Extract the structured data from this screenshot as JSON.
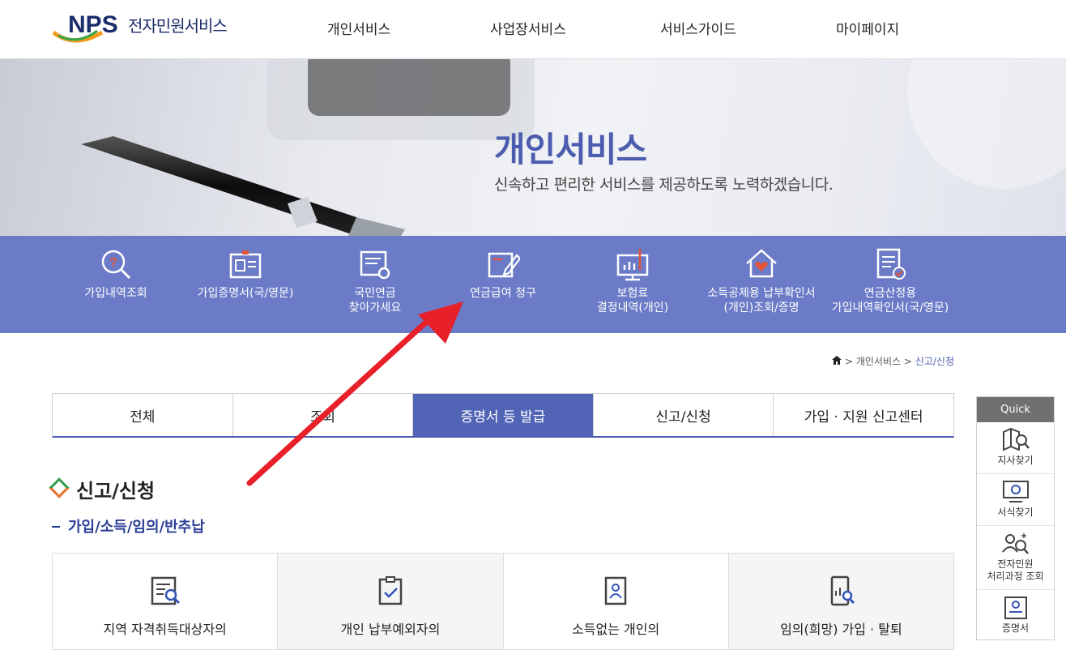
{
  "header": {
    "logo_mark": "NPS",
    "logo_text": "전자민원서비스",
    "nav": [
      "개인서비스",
      "사업장서비스",
      "서비스가이드",
      "마이페이지"
    ]
  },
  "hero": {
    "title": "개인서비스",
    "subtitle": "신속하고 편리한 서비스를 제공하도록 노력하겠습니다."
  },
  "services": [
    {
      "line1": "가입내역조회",
      "line2": "",
      "icon": "search-question-icon"
    },
    {
      "line1": "가입증명서(국/영문)",
      "line2": "",
      "icon": "id-card-icon"
    },
    {
      "line1": "국민연금",
      "line2": "찾아가세요",
      "icon": "document-search-icon"
    },
    {
      "line1": "연금급여 청구",
      "line2": "",
      "icon": "pen-edit-icon"
    },
    {
      "line1": "보험료",
      "line2": "결정내역(개인)",
      "icon": "monitor-chart-icon"
    },
    {
      "line1": "소득공제용 납부확인서",
      "line2": "(개인)조회/증명",
      "icon": "house-heart-icon"
    },
    {
      "line1": "연금산정용",
      "line2": "가입내역확인서(국/영문)",
      "icon": "document-check-icon"
    }
  ],
  "breadcrumb": {
    "level1": "개인서비스",
    "current": "신고/신청"
  },
  "tabs": [
    "전체",
    "조회",
    "증명서 등 발급",
    "신고/신청",
    "가입 · 지원 신고센터"
  ],
  "active_tab": "증명서 등 발급",
  "section": {
    "title": "신고/신청",
    "subtitle": "가입/소득/임의/반추납",
    "cards": [
      "지역 자격취득대상자의",
      "개인 납부예외자의",
      "소득없는 개인의",
      "임의(희망) 가입 · 탈퇴"
    ]
  },
  "quick": {
    "title": "Quick",
    "items": [
      {
        "line1": "지사찾기",
        "line2": ""
      },
      {
        "line1": "서식찾기",
        "line2": ""
      },
      {
        "line1": "전자민원",
        "line2": "처리과정 조회"
      },
      {
        "line1": "증명서",
        "line2": ""
      }
    ]
  },
  "colors": {
    "accent": "#5164b5",
    "band": "#6b7bc7",
    "annotation_arrow": "#e8202a"
  }
}
